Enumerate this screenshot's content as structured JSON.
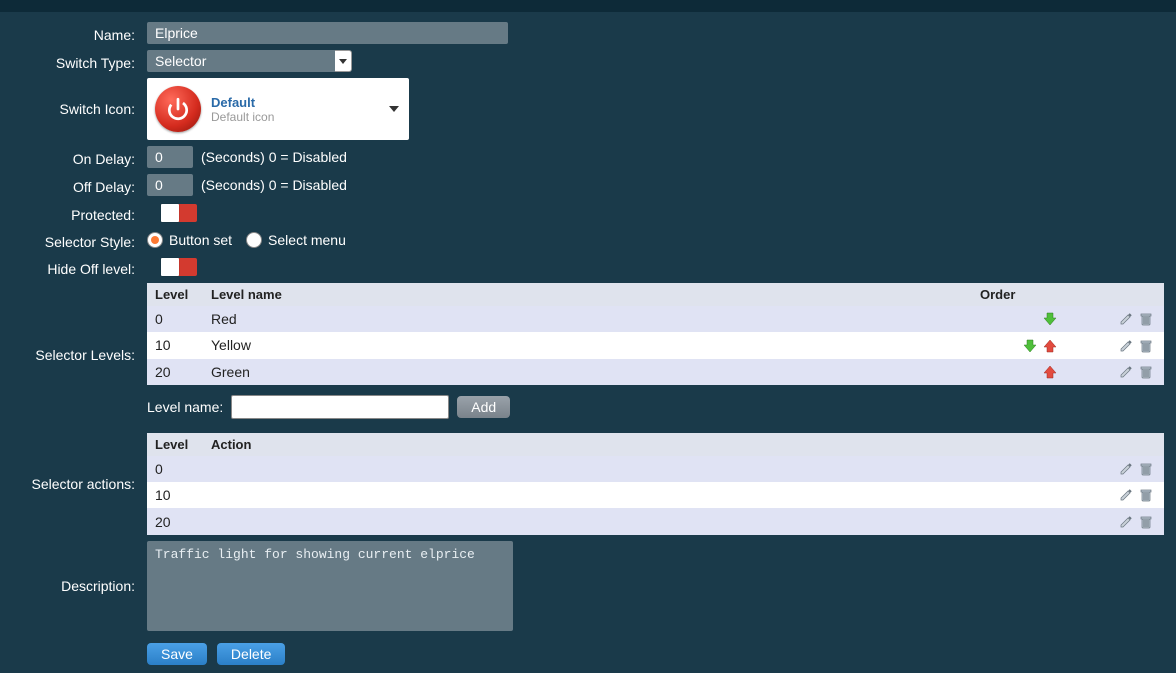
{
  "labels": {
    "name": "Name:",
    "switch_type": "Switch Type:",
    "switch_icon": "Switch Icon:",
    "on_delay": "On Delay:",
    "off_delay": "Off Delay:",
    "protected": "Protected:",
    "selector_style": "Selector Style:",
    "hide_off_level": "Hide Off level:",
    "selector_levels": "Selector Levels:",
    "selector_actions": "Selector actions:",
    "description": "Description:",
    "level_name": "Level name:"
  },
  "fields": {
    "name": "Elprice",
    "switch_type": "Selector",
    "icon_title": "Default",
    "icon_subtitle": "Default icon",
    "on_delay_value": "0",
    "off_delay_value": "0",
    "delay_hint": "(Seconds) 0 = Disabled",
    "protected": false,
    "hide_off_level": false,
    "selector_style": "button_set",
    "style_option_button": "Button set",
    "style_option_select": "Select menu",
    "level_name_value": "",
    "description": "Traffic light for showing current elprice"
  },
  "levels_table": {
    "headers": {
      "level": "Level",
      "name": "Level name",
      "order": "Order"
    },
    "rows": [
      {
        "level": "0",
        "name": "Red",
        "up": false,
        "down": true
      },
      {
        "level": "10",
        "name": "Yellow",
        "up": true,
        "down": true
      },
      {
        "level": "20",
        "name": "Green",
        "up": true,
        "down": false
      }
    ]
  },
  "actions_table": {
    "headers": {
      "level": "Level",
      "action": "Action"
    },
    "rows": [
      {
        "level": "0",
        "action": ""
      },
      {
        "level": "10",
        "action": ""
      },
      {
        "level": "20",
        "action": ""
      }
    ]
  },
  "buttons": {
    "add": "Add",
    "save": "Save",
    "delete": "Delete"
  }
}
